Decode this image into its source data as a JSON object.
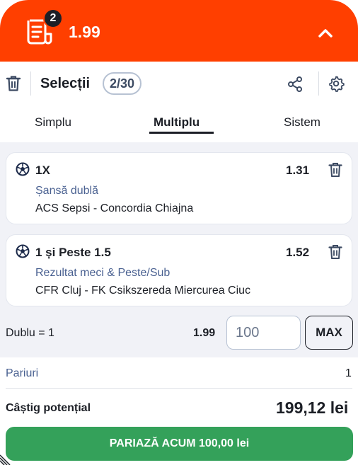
{
  "header": {
    "slip_count": "2",
    "total_odds": "1.99",
    "icons": {
      "slip": "bet-slip-icon",
      "collapse": "chevron-up-icon"
    },
    "color": "#ff3f00"
  },
  "toolbar": {
    "title": "Selecții",
    "selection_count": "2/30",
    "icons": {
      "delete": "trash-icon",
      "share": "share-icon",
      "settings": "gear-icon"
    }
  },
  "tabs": [
    {
      "label": "Simplu",
      "active": false
    },
    {
      "label": "Multiplu",
      "active": true
    },
    {
      "label": "Sistem",
      "active": false
    }
  ],
  "selections": [
    {
      "pick": "1X",
      "odds": "1.31",
      "market": "Șansă dublă",
      "event": "ACS Sepsi - Concordia Chiajna"
    },
    {
      "pick": "1 și Peste 1.5",
      "odds": "1.52",
      "market": "Rezultat meci & Peste/Sub",
      "event": "CFR Cluj - FK Csikszereda Miercurea Ciuc"
    }
  ],
  "stake": {
    "combo_label": "Dublu = 1",
    "combo_odds": "1.99",
    "amount": "100",
    "max_label": "MAX"
  },
  "summary": {
    "bets_label": "Pariuri",
    "bets_value": "1",
    "potential_win_label": "Câștig potențial",
    "potential_win_value": "199,12 lei"
  },
  "place_bet_label": "PARIAZĂ ACUM 100,00 lei",
  "colors": {
    "accent": "#ff3f00",
    "confirm": "#34a15a",
    "market_text": "#4a6191"
  }
}
